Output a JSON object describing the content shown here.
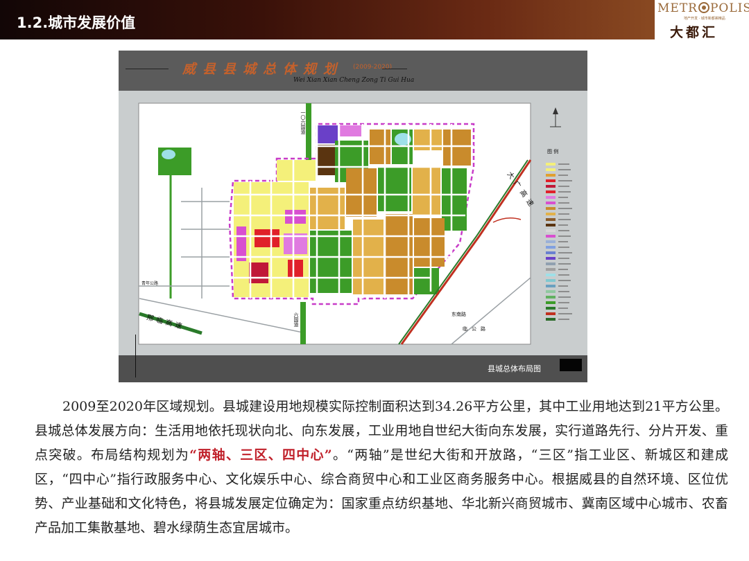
{
  "header": {
    "title": "1.2.城市发展价值",
    "logo_word_pre": "METR",
    "logo_word_post": "POLIS",
    "logo_sub": "地产开发 · 城市新都荟精品",
    "logo_cn": "大都汇"
  },
  "map": {
    "title": "威县县城总体规划",
    "years": "(2009-2020)",
    "pinyin": "Wei Xian Xian Cheng Zong Ti Gui Hua",
    "caption": "县城总体布局图",
    "labels": {
      "north_road": "一〇六国道",
      "south_road": "六国道",
      "expressway": "邢临高速",
      "east_highway": "大广高速",
      "west_road": "青年公路",
      "se_road1": "东南路",
      "se_road2": "临公路",
      "legend": "图 例"
    },
    "colors": {
      "residential": "#f4f07a",
      "industrial": "#c98b2c",
      "industrial_light": "#e2b14a",
      "green": "#3c9c28",
      "commercial": "#e0202a",
      "public": "#d84fd0",
      "boundary": "#c83cc8",
      "water": "#9ee0e8"
    }
  },
  "body": {
    "p1": "2009至2020年区域规划。县城建设用地规模实际控制面积达到34.26平方公里，其中工业用地达到21平方公里。县城总体发展方向：生活用地依托现状向北、向东发展，工业用地自世纪大街向东发展，实行道路先行、分片开发、重点突破。布局结构规划为",
    "highlight": "“两轴、三区、四中心”",
    "p2": "。“两轴”是世纪大街和开放路，“三区”指工业区、新城区和建成区，“四中心”指行政服务中心、文化娱乐中心、综合商贸中心和工业区商务服务中心。根据威县的自然环境、区位优势、产业基础和文化特色，将县城发展定位确定为：国家重点纺织基地、华北新兴商贸城市、冀南区域中心城市、农畜产品加工集散基地、碧水绿荫生态宜居城市。"
  }
}
